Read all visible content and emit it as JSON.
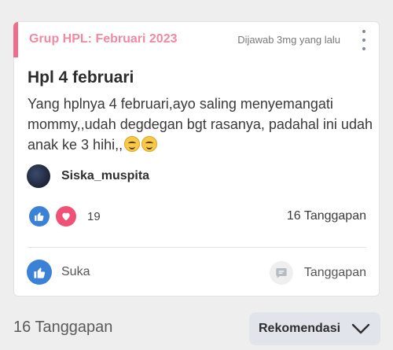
{
  "post": {
    "group": "Grup HPL: Februari 2023",
    "answered": "Dijawab 3mg yang lalu",
    "title": "Hpl 4 februari",
    "body": "Yang hplnya 4 februari,ayo saling menyemangati mommy,,udah degdegan bgt rasanya, padahal ini udah anak ke 3 hihi,,",
    "emoji_count": 2,
    "author": "Siska_muspita",
    "reaction_count": "19",
    "response_count": "16 Tanggapan"
  },
  "actions": {
    "like_label": "Suka",
    "respond_label": "Tanggapan"
  },
  "footer": {
    "responses_label": "16 Tanggapan",
    "sort_label": "Rekomendasi"
  },
  "colors": {
    "accent": "#f26b8a",
    "group_text": "#f08aa2",
    "like_blue": "#3b82d6",
    "love_red": "#ef5275"
  },
  "icons": [
    "more-vertical-icon",
    "thumbs-up-icon",
    "heart-icon",
    "comment-icon",
    "chevron-down-icon",
    "smile-emoji-icon"
  ]
}
